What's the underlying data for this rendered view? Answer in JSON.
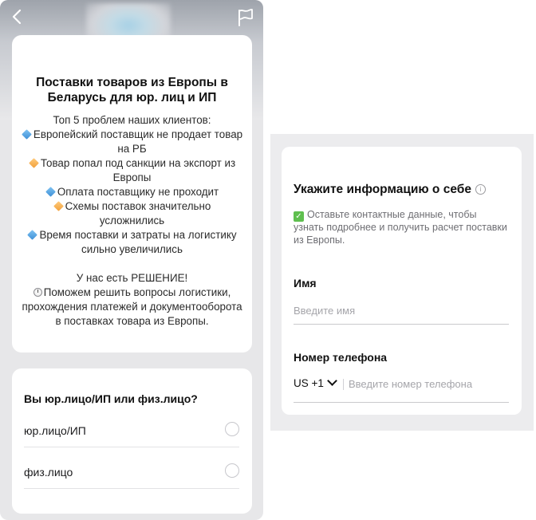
{
  "left_screen": {
    "info_card": {
      "title": "Поставки товаров из Европы в Беларусь для юр. лиц и ИП",
      "intro": "Топ 5 проблем наших клиентов:",
      "problems": [
        {
          "marker": "blue-diamond",
          "text": "Европейский поставщик не продает товар на РБ"
        },
        {
          "marker": "orange-diamond",
          "text": "Товар попал под санкции на экспорт из Европы"
        },
        {
          "marker": "blue-diamond",
          "text": "Оплата поставщику не проходит"
        },
        {
          "marker": "orange-diamond",
          "text": "Схемы поставок значительно усложнились"
        },
        {
          "marker": "blue-diamond",
          "text": "Время поставки и затраты на логистику сильно увеличились"
        }
      ],
      "solution_heading": "У нас есть РЕШЕНИЕ!",
      "solution_text": "Поможем решить вопросы логистики, прохождения платежей и документооборота в поставках товара из Европы."
    },
    "question": {
      "title": "Вы юр.лицо/ИП или физ.лицо?",
      "options": [
        {
          "label": "юр.лицо/ИП",
          "selected": false
        },
        {
          "label": "физ.лицо",
          "selected": false
        }
      ]
    }
  },
  "form": {
    "title": "Укажите информацию о себе",
    "description": "Оставьте контактные данные, чтобы узнать подробнее и получить расчет поставки из Европы.",
    "name_field": {
      "label": "Имя",
      "placeholder": "Введите имя",
      "value": ""
    },
    "phone_field": {
      "label": "Номер телефона",
      "country_code": "US +1",
      "placeholder": "Введите номер телефона",
      "value": ""
    }
  },
  "icons": {
    "back": "chevron-left-icon",
    "flag": "flag-icon",
    "info": "info-icon",
    "check": "checkmark-icon",
    "clock": "clock-icon"
  },
  "colors": {
    "accent_blue": "#3e8fd6",
    "accent_orange": "#f2a03a",
    "check_green": "#5fbf4f",
    "muted_text": "#6e6e73"
  }
}
